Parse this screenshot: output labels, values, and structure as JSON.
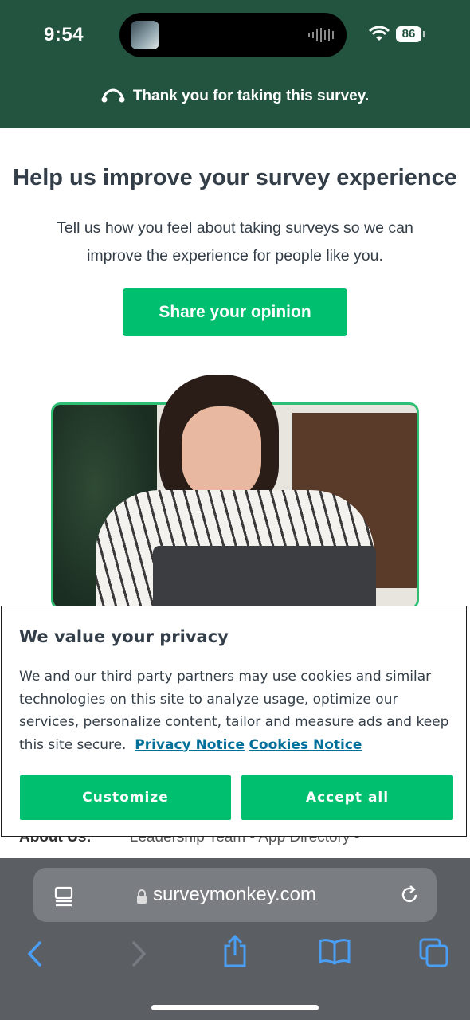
{
  "status_bar": {
    "time": "9:54",
    "battery": "86"
  },
  "banner": {
    "text": "Thank you for taking this survey."
  },
  "main": {
    "headline": "Help us improve your survey experience",
    "subtext": "Tell us how you feel about taking surveys so we can improve the experience for people like you.",
    "cta_label": "Share your opinion"
  },
  "underlay": {
    "about_label": "About Us:",
    "links": "Leadership Team • App Directory •"
  },
  "cookie": {
    "title": "We value your privacy",
    "body": "We and our third party partners may use cookies and similar technologies on this site to analyze usage, optimize our services, personalize content, tailor and measure ads and keep this site secure.",
    "privacy_link": "Privacy Notice",
    "cookies_link": "Cookies Notice",
    "customize_label": "Customize",
    "accept_label": "Accept all"
  },
  "browser": {
    "url": "surveymonkey.com"
  },
  "colors": {
    "header_bg": "#23543f",
    "accent": "#00bf6f",
    "link": "#00709b",
    "browser_bg": "#5b5e63",
    "ios_blue": "#4a9ff5"
  }
}
